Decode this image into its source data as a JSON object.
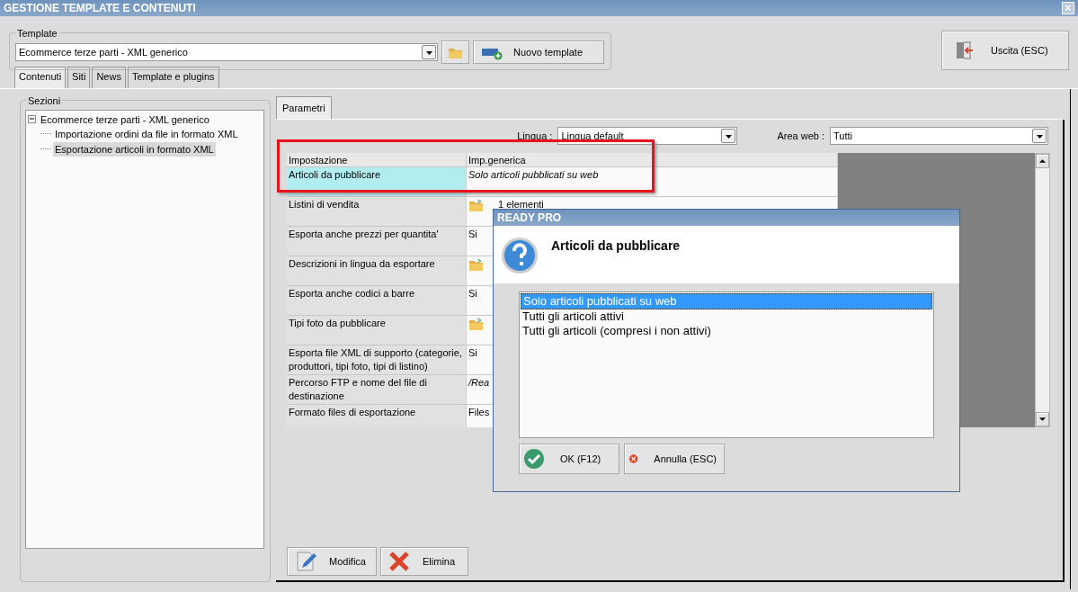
{
  "window": {
    "title": "GESTIONE TEMPLATE E CONTENUTI",
    "close": "×"
  },
  "template": {
    "label": "Template",
    "value": "Ecommerce terze parti - XML generico",
    "new_button": "Nuovo template"
  },
  "exit_button": "Uscita (ESC)",
  "tabs": [
    {
      "label": "Contenuti",
      "selected": true
    },
    {
      "label": "Siti",
      "selected": false
    },
    {
      "label": "News",
      "selected": false
    },
    {
      "label": "Template e plugins",
      "selected": false
    }
  ],
  "sections": {
    "label": "Sezioni",
    "tree": [
      {
        "label": "Ecommerce terze parti - XML generico",
        "expanded": true,
        "selected": false,
        "children": [
          {
            "label": "Importazione ordini da file in formato XML",
            "selected": false
          },
          {
            "label": "Esportazione articoli in formato XML",
            "selected": true
          }
        ]
      }
    ]
  },
  "params": {
    "tab": "Parametri",
    "language_label": "Lingua :",
    "language": "Lingua default",
    "area_label": "Area web :",
    "area": "Tutti",
    "columns": [
      "Impostazione",
      "Imp.generica"
    ],
    "rows": [
      {
        "setting": "Articoli da pubblicare",
        "kind": "italic",
        "value": "Solo articoli pubblicati su web",
        "selected": true
      },
      {
        "setting": "Listini di vendita",
        "kind": "folder",
        "value": "1 elementi",
        "selected": false
      },
      {
        "setting": "Esporta anche prezzi per quantita'",
        "kind": "text",
        "value": "Si",
        "selected": false
      },
      {
        "setting": "Descrizioni in lingua da esportare",
        "kind": "folder",
        "selected": false
      },
      {
        "setting": "Esporta anche codici a barre",
        "kind": "text",
        "value": "Si",
        "selected": false
      },
      {
        "setting": "Tipi foto da pubblicare",
        "kind": "folder",
        "selected": false
      },
      {
        "setting": "Esporta file XML di supporto (categorie, produttori, tipi foto, tipi di listino)",
        "kind": "text",
        "value": "Si",
        "selected": false
      },
      {
        "setting": "Percorso FTP e nome del file di destinazione",
        "kind": "italic",
        "value": "/Rea",
        "selected": false
      },
      {
        "setting": "Formato files di esportazione",
        "kind": "text",
        "value": "Files",
        "selected": false
      }
    ],
    "buttons": [
      {
        "label": "Modifica",
        "kind": "edit"
      },
      {
        "label": "Elimina",
        "kind": "delete"
      }
    ]
  },
  "dialog": {
    "title": "READY PRO",
    "heading": "Articoli da pubblicare",
    "options": [
      {
        "label": "Solo articoli pubblicati su web",
        "selected": true
      },
      {
        "label": "Tutti gli articoli attivi",
        "selected": false
      },
      {
        "label": "Tutti gli articoli (compresi i non attivi)",
        "selected": false
      }
    ],
    "buttons": [
      {
        "label": "OK (F12)",
        "kind": "ok"
      },
      {
        "label": "Annulla (ESC)",
        "kind": "cancel"
      }
    ]
  }
}
